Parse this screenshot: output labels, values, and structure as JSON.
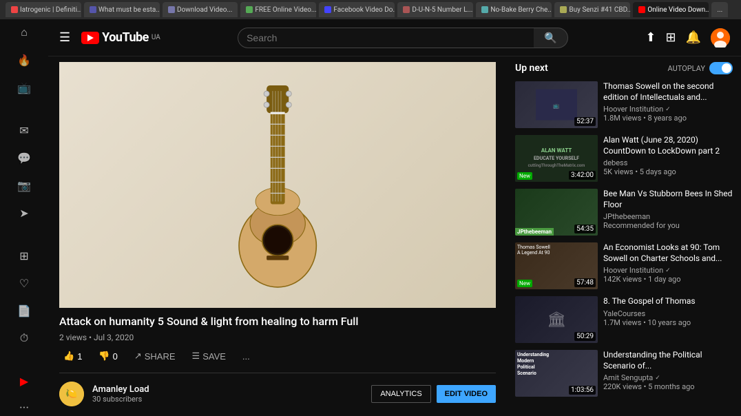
{
  "browser": {
    "tabs": [
      {
        "label": "Iatrogenic | Definiti...",
        "active": false
      },
      {
        "label": "What must be esta...",
        "active": false
      },
      {
        "label": "Download Video...",
        "active": false
      },
      {
        "label": "FREE Online Video...",
        "active": false
      },
      {
        "label": "Facebook Video Do...",
        "active": false
      },
      {
        "label": "D-U-N-5 Number L...",
        "active": false
      },
      {
        "label": "No-Bake Berry Che...",
        "active": false
      },
      {
        "label": "Buy Senzi #41 CBD...",
        "active": false
      },
      {
        "label": "Online Video Down...",
        "active": true
      },
      {
        "label": "...",
        "active": false
      }
    ]
  },
  "header": {
    "menu_label": "☰",
    "logo_text": "YouTube",
    "logo_country": "UA",
    "search_placeholder": "Search",
    "search_icon": "🔍"
  },
  "sidebar": {
    "icons": [
      {
        "name": "home",
        "symbol": "⌂",
        "label": ""
      },
      {
        "name": "trending",
        "symbol": "▶",
        "label": ""
      },
      {
        "name": "subscriptions",
        "symbol": "📺",
        "label": ""
      },
      {
        "name": "messages",
        "symbol": "✉",
        "label": ""
      },
      {
        "name": "whatsapp",
        "symbol": "💬",
        "label": ""
      },
      {
        "name": "instagram",
        "symbol": "📷",
        "label": ""
      },
      {
        "name": "send",
        "symbol": "➤",
        "label": ""
      },
      {
        "name": "apps",
        "symbol": "⊞",
        "label": ""
      },
      {
        "name": "library",
        "symbol": "♡",
        "label": ""
      },
      {
        "name": "history",
        "symbol": "📄",
        "label": ""
      },
      {
        "name": "clock",
        "symbol": "⏱",
        "label": ""
      },
      {
        "name": "yt-red",
        "symbol": "▶",
        "label": ""
      }
    ]
  },
  "video": {
    "title": "Attack on humanity 5 Sound & light from healing to harm Full",
    "views": "2 views",
    "date": "Jul 3, 2020",
    "likes": "1",
    "dislikes": "0",
    "share_label": "SHARE",
    "save_label": "SAVE",
    "more_label": "...",
    "channel_name": "Amanley Load",
    "channel_subs": "30 subscribers",
    "analytics_label": "ANALYTICS",
    "edit_label": "EDIT VIDEO"
  },
  "upnext": {
    "title": "Up next",
    "autoplay_label": "AUTOPLAY",
    "items": [
      {
        "title": "Thomas Sowell on the second edition of Intellectuals and...",
        "channel": "Hoover Institution",
        "verified": true,
        "meta": "1.8M views • 8 years ago",
        "duration": "52:37",
        "thumb_class": "thumb-1",
        "thumb_text": ""
      },
      {
        "title": "Alan Watt (June 28, 2020) CountDown to LockDown part 2",
        "channel": "debess",
        "verified": false,
        "meta": "5K views • 5 days ago",
        "duration": "3:42:00",
        "badge": "New",
        "thumb_class": "thumb-2",
        "thumb_text": "ALAN WATT\nEDUCATE YOURSELF"
      },
      {
        "title": "Bee Man Vs Stubborn Bees In Shed Floor",
        "channel": "JPthebeeman",
        "verified": false,
        "meta": "Recommended for you",
        "duration": "54:35",
        "thumb_class": "thumb-3",
        "thumb_text": "JPthebeeman"
      },
      {
        "title": "An Economist Looks at 90: Tom Sowell on Charter Schools and...",
        "channel": "Hoover Institution",
        "verified": true,
        "meta": "142K views • 1 day ago",
        "duration": "57:48",
        "badge": "New",
        "thumb_class": "thumb-4",
        "thumb_text": "Thomas Sowell\nA Legend At 90"
      },
      {
        "title": "8. The Gospel of Thomas",
        "channel": "YaleCourses",
        "verified": false,
        "meta": "1.7M views • 10 years ago",
        "duration": "50:29",
        "thumb_class": "thumb-5",
        "thumb_text": ""
      },
      {
        "title": "Understanding the Political Scenario of...",
        "channel": "Amit Sengupta",
        "verified": true,
        "meta": "220K views • 5 months ago",
        "duration": "1:03:56",
        "thumb_class": "thumb-6",
        "thumb_text": "Understanding\nModern\nPolitical\nScenario"
      }
    ]
  }
}
